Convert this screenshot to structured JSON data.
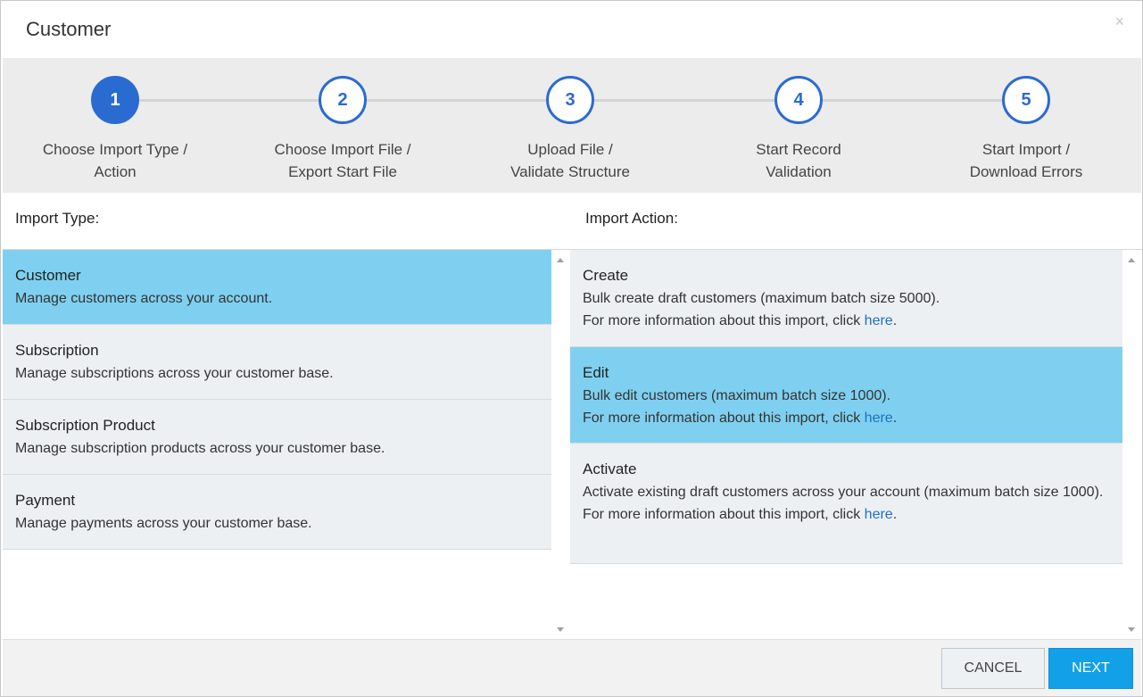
{
  "dialog": {
    "title": "Customer",
    "close_glyph": "×"
  },
  "stepper": {
    "steps": [
      {
        "number": "1",
        "line1": "Choose Import Type /",
        "line2": "Action",
        "active": true
      },
      {
        "number": "2",
        "line1": "Choose Import File /",
        "line2": "Export Start File",
        "active": false
      },
      {
        "number": "3",
        "line1": "Upload File /",
        "line2": "Validate Structure",
        "active": false
      },
      {
        "number": "4",
        "line1": "Start Record",
        "line2": "Validation",
        "active": false
      },
      {
        "number": "5",
        "line1": "Start Import /",
        "line2": "Download Errors",
        "active": false
      }
    ]
  },
  "import_type": {
    "heading": "Import Type:",
    "items": [
      {
        "name": "Customer",
        "desc": "Manage customers across your account.",
        "selected": true
      },
      {
        "name": "Subscription",
        "desc": "Manage subscriptions across your customer base.",
        "selected": false
      },
      {
        "name": "Subscription Product",
        "desc": "Manage subscription products across your customer base.",
        "selected": false
      },
      {
        "name": "Payment",
        "desc": "Manage payments across your customer base.",
        "selected": false
      }
    ]
  },
  "import_action": {
    "heading": "Import Action:",
    "more_prefix": "For more information about this import, click ",
    "more_link": "here",
    "more_suffix": ".",
    "items": [
      {
        "name": "Create",
        "desc": "Bulk create draft customers (maximum batch size 5000).",
        "selected": false
      },
      {
        "name": "Edit",
        "desc": "Bulk edit customers (maximum batch size 1000).",
        "selected": true
      },
      {
        "name": "Activate",
        "desc": "Activate existing draft customers across your account (maximum batch size 1000).",
        "selected": false
      }
    ]
  },
  "footer": {
    "cancel_label": "CANCEL",
    "next_label": "NEXT"
  },
  "colors": {
    "accent": "#2a6bd2",
    "selected_row": "#7fd0f0",
    "primary_button": "#12a0e8",
    "link": "#1e6fc0"
  },
  "icons": {
    "close": "close-icon",
    "scroll_up": "scroll-up-arrow-icon",
    "scroll_down": "scroll-down-arrow-icon"
  }
}
